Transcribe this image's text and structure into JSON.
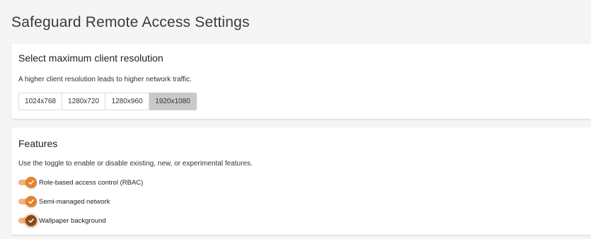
{
  "page": {
    "title": "Safeguard Remote Access Settings"
  },
  "resolution": {
    "title": "Select maximum client resolution",
    "description": "A higher client resolution leads to higher network traffic.",
    "options": [
      "1024x768",
      "1280x720",
      "1280x960",
      "1920x1080"
    ],
    "selected": "1920x1080"
  },
  "features": {
    "title": "Features",
    "description": "Use the toggle to enable or disable existing, new, or experimental features.",
    "items": [
      {
        "label": "Role-based access control (RBAC)",
        "enabled": true
      },
      {
        "label": "Semi-managed network",
        "enabled": true
      },
      {
        "label": "Wallpaper background",
        "enabled": true
      }
    ]
  },
  "colors": {
    "accent": "#e8812c",
    "accent_track": "#f2b27a",
    "selected_button": "#c9c9c9"
  },
  "icons": {
    "toggle_on": "check-icon"
  }
}
